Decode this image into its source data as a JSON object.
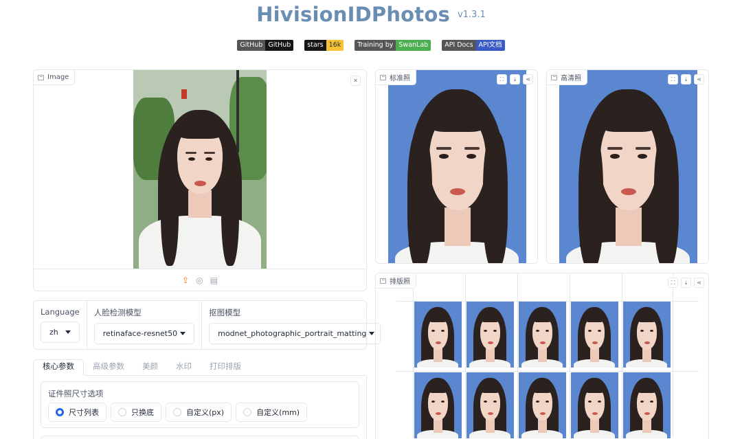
{
  "header": {
    "title": "HivisionIDPhotos",
    "version": "v1.3.1"
  },
  "badges": [
    {
      "left": "GitHub",
      "right": "GitHub",
      "right_color": "#151515"
    },
    {
      "left": "stars",
      "right": "16k",
      "right_color": "#f7c233"
    },
    {
      "left": "Training by",
      "right": "SwanLab",
      "right_color": "#4cae4f"
    },
    {
      "left": "API Docs",
      "right": "API文档",
      "right_color": "#3a5bc7"
    }
  ],
  "input_panel": {
    "label": "Image",
    "close_icon": "close-icon",
    "source_icons": [
      "upload-icon",
      "webcam-icon",
      "clipboard-icon"
    ]
  },
  "output_standard": {
    "label": "标准照"
  },
  "output_hd": {
    "label": "高清照"
  },
  "output_layout": {
    "label": "排版照"
  },
  "dropdowns": {
    "language": {
      "label": "Language",
      "value": "zh"
    },
    "face_model": {
      "label": "人脸检测模型",
      "value": "retinaface-resnet50"
    },
    "matting_model": {
      "label": "抠图模型",
      "value": "modnet_photographic_portrait_matting"
    }
  },
  "tabs": [
    {
      "label": "核心参数",
      "active": true
    },
    {
      "label": "高级参数",
      "active": false
    },
    {
      "label": "美颜",
      "active": false
    },
    {
      "label": "水印",
      "active": false
    },
    {
      "label": "打印排版",
      "active": false
    }
  ],
  "size_options": {
    "label": "证件照尺寸选项",
    "options": [
      {
        "label": "尺寸列表",
        "selected": true
      },
      {
        "label": "只换底",
        "selected": false
      },
      {
        "label": "自定义(px)",
        "selected": false
      },
      {
        "label": "自定义(mm)",
        "selected": false
      }
    ]
  },
  "colors": {
    "title": "#6a8eb3",
    "id_photo_background": "#5b87d1",
    "selected_radio": "#2563eb",
    "upload_active": "#f97316"
  }
}
